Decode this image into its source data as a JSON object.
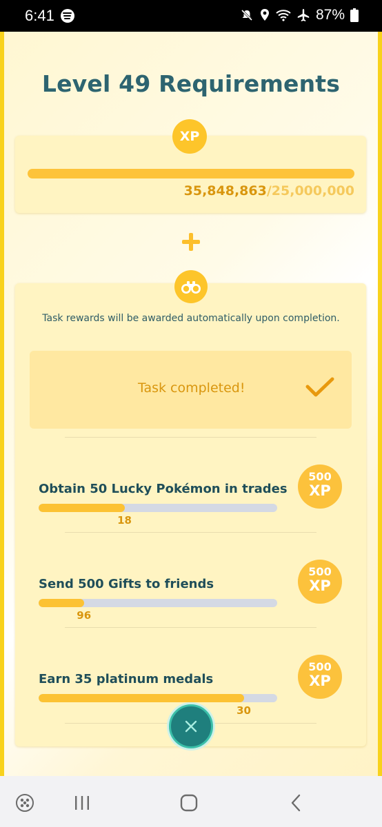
{
  "status_bar": {
    "time": "6:41",
    "battery": "87%",
    "icons": [
      "spotify-icon",
      "mute-icon",
      "location-icon",
      "wifi-icon",
      "airplane-icon",
      "battery-icon"
    ]
  },
  "page": {
    "title": "Level 49 Requirements"
  },
  "xp_requirement": {
    "badge": "XP",
    "current": "35,848,863",
    "separator": "/",
    "target": "25,000,000",
    "progress_fraction": 1.0
  },
  "tasks_section": {
    "info": "Task rewards will be awarded automatically upon completion.",
    "completed_label": "Task completed!",
    "items": [
      {
        "title": "Obtain 50 Lucky Pokémon in trades",
        "count": "18",
        "progress_fraction": 0.36,
        "reward_amount": "500",
        "reward_unit": "XP"
      },
      {
        "title": "Send 500 Gifts to friends",
        "count": "96",
        "progress_fraction": 0.19,
        "reward_amount": "500",
        "reward_unit": "XP"
      },
      {
        "title": "Earn 35 platinum medals",
        "count": "30",
        "progress_fraction": 0.86,
        "reward_amount": "500",
        "reward_unit": "XP"
      }
    ]
  },
  "colors": {
    "accent_gold": "#fdc52a",
    "title_teal": "#2d6470",
    "count_orange": "#d9960e",
    "close_teal": "#1f7f7d"
  },
  "nav_bar": {
    "icons": [
      "game-launcher-icon",
      "recent-apps-icon",
      "home-icon",
      "back-icon"
    ]
  }
}
